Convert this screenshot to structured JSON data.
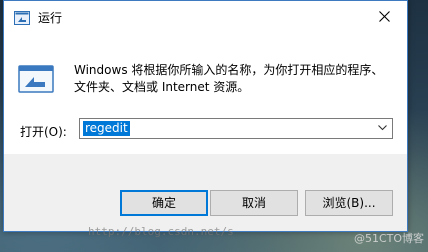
{
  "window": {
    "title": "运行",
    "close_glyph": "✕"
  },
  "dialog": {
    "description": "Windows 将根据你所输入的名称，为你打开相应的程序、文件夹、文档或 Internet 资源。",
    "open_label": "打开(O):",
    "open_value": "regedit"
  },
  "buttons": {
    "ok": "确定",
    "cancel": "取消",
    "browse": "浏览(B)..."
  },
  "watermark": {
    "url_text": "http://blog.csdn.net/s",
    "brand_text": "@51CTO博客"
  },
  "icons": {
    "app": "run-app-icon",
    "run": "run-dialog-icon",
    "close": "close-icon",
    "dropdown": "chevron-down-icon"
  },
  "colors": {
    "accent": "#0078d7",
    "window_border": "#3e7ac0",
    "footer_bg": "#f0f0f0",
    "button_bg": "#e1e1e1"
  }
}
